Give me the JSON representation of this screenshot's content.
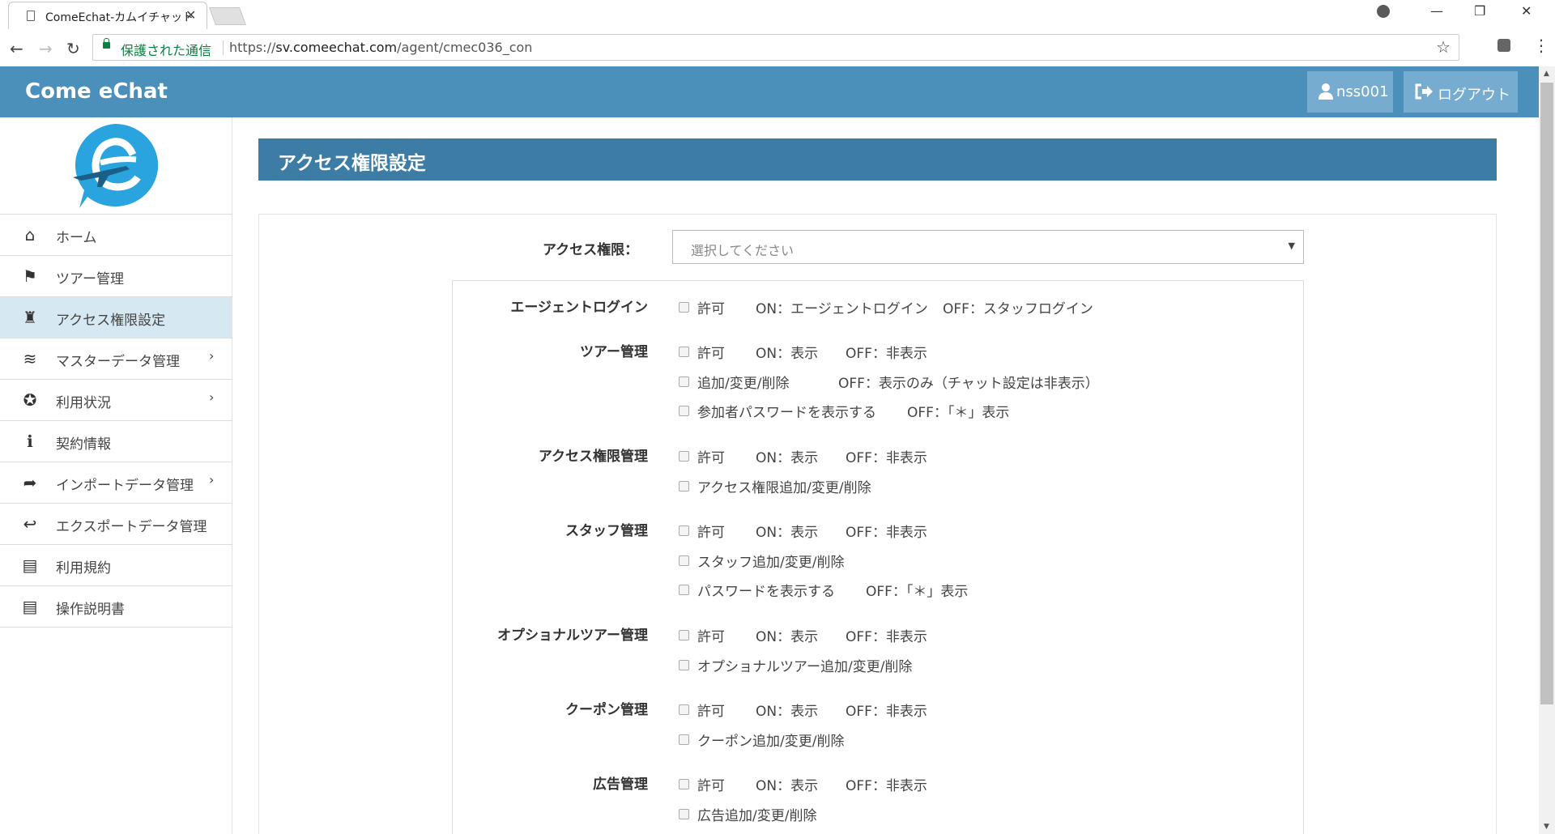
{
  "browser": {
    "tab_title": "ComeEchat-カムイチャット",
    "secure_label": "保護された通信",
    "url_scheme": "https://",
    "url_host": "sv.comeechat.com",
    "url_path": "/agent/cmec036_con"
  },
  "header": {
    "brand": "Come eChat",
    "user": "nss001",
    "logout": "ログアウト"
  },
  "sidebar": {
    "items": [
      {
        "label": "ホーム",
        "icon": "home-icon",
        "has_sub": false,
        "active": false
      },
      {
        "label": "ツアー管理",
        "icon": "flag-icon",
        "has_sub": false,
        "active": false
      },
      {
        "label": "アクセス権限設定",
        "icon": "user-secret-icon",
        "has_sub": false,
        "active": true
      },
      {
        "label": "マスターデータ管理",
        "icon": "database-icon",
        "has_sub": true,
        "active": false
      },
      {
        "label": "利用状況",
        "icon": "rebel-icon",
        "has_sub": true,
        "active": false
      },
      {
        "label": "契約情報",
        "icon": "info-icon",
        "has_sub": false,
        "active": false
      },
      {
        "label": "インポートデータ管理",
        "icon": "share-icon",
        "has_sub": true,
        "active": false
      },
      {
        "label": "エクスポートデータ管理",
        "icon": "reply-icon",
        "has_sub": false,
        "active": false
      },
      {
        "label": "利用規約",
        "icon": "book-icon",
        "has_sub": false,
        "active": false
      },
      {
        "label": "操作説明書",
        "icon": "book-icon",
        "has_sub": false,
        "active": false
      }
    ]
  },
  "main": {
    "page_title": "アクセス権限設定",
    "access_label": "アクセス権限：",
    "access_placeholder": "選択してください",
    "groups": [
      {
        "label": "エージェントログイン",
        "options": [
          {
            "label": "許可",
            "note1": "ON：エージェントログイン",
            "note2": "OFF：スタッフログイン"
          }
        ]
      },
      {
        "label": "ツアー管理",
        "options": [
          {
            "label": "許可",
            "note1": "ON：表示",
            "note2": "OFF：非表示"
          },
          {
            "label": "追加/変更/削除",
            "note1": "OFF：表示のみ（チャット設定は非表示）",
            "note2": ""
          },
          {
            "label": "参加者パスワードを表示する",
            "note1": "OFF：「＊」表示",
            "note2": ""
          }
        ]
      },
      {
        "label": "アクセス権限管理",
        "options": [
          {
            "label": "許可",
            "note1": "ON：表示",
            "note2": "OFF：非表示"
          },
          {
            "label": "アクセス権限追加/変更/削除",
            "note1": "",
            "note2": ""
          }
        ]
      },
      {
        "label": "スタッフ管理",
        "options": [
          {
            "label": "許可",
            "note1": "ON：表示",
            "note2": "OFF：非表示"
          },
          {
            "label": "スタッフ追加/変更/削除",
            "note1": "",
            "note2": ""
          },
          {
            "label": "パスワードを表示する",
            "note1": "OFF：「＊」表示",
            "note2": ""
          }
        ]
      },
      {
        "label": "オプショナルツアー管理",
        "options": [
          {
            "label": "許可",
            "note1": "ON：表示",
            "note2": "OFF：非表示"
          },
          {
            "label": "オプショナルツアー追加/変更/削除",
            "note1": "",
            "note2": ""
          }
        ]
      },
      {
        "label": "クーポン管理",
        "options": [
          {
            "label": "許可",
            "note1": "ON：表示",
            "note2": "OFF：非表示"
          },
          {
            "label": "クーポン追加/変更/削除",
            "note1": "",
            "note2": ""
          }
        ]
      },
      {
        "label": "広告管理",
        "options": [
          {
            "label": "許可",
            "note1": "ON：表示",
            "note2": "OFF：非表示"
          },
          {
            "label": "広告追加/変更/削除",
            "note1": "",
            "note2": ""
          }
        ]
      }
    ]
  }
}
